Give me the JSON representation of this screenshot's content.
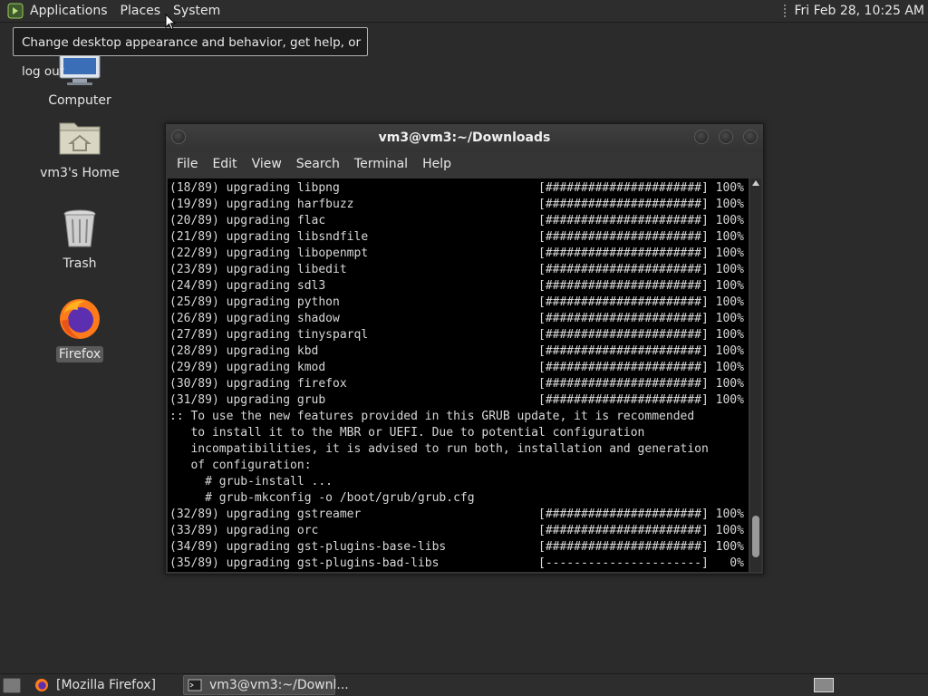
{
  "top_panel": {
    "menus": [
      "Applications",
      "Places",
      "System"
    ],
    "clock": "Fri Feb 28, 10:25 AM"
  },
  "tooltip": {
    "text": "Change desktop appearance and behavior, get help, or log out"
  },
  "desktop": {
    "icons": [
      {
        "label": "Computer",
        "icon": "computer-icon"
      },
      {
        "label": "vm3's Home",
        "icon": "home-folder-icon"
      },
      {
        "label": "Trash",
        "icon": "trash-icon"
      },
      {
        "label": "Firefox",
        "icon": "firefox-icon",
        "selected": true
      }
    ]
  },
  "terminal": {
    "title": "vm3@vm3:~/Downloads",
    "menu": [
      "File",
      "Edit",
      "View",
      "Search",
      "Terminal",
      "Help"
    ],
    "lines": [
      "(18/89) upgrading libpng                            [######################] 100%",
      "(19/89) upgrading harfbuzz                          [######################] 100%",
      "(20/89) upgrading flac                              [######################] 100%",
      "(21/89) upgrading libsndfile                        [######################] 100%",
      "(22/89) upgrading libopenmpt                        [######################] 100%",
      "(23/89) upgrading libedit                           [######################] 100%",
      "(24/89) upgrading sdl3                              [######################] 100%",
      "(25/89) upgrading python                            [######################] 100%",
      "(26/89) upgrading shadow                            [######################] 100%",
      "(27/89) upgrading tinysparql                        [######################] 100%",
      "(28/89) upgrading kbd                               [######################] 100%",
      "(29/89) upgrading kmod                              [######################] 100%",
      "(30/89) upgrading firefox                           [######################] 100%",
      "(31/89) upgrading grub                              [######################] 100%",
      ":: To use the new features provided in this GRUB update, it is recommended",
      "   to install it to the MBR or UEFI. Due to potential configuration",
      "   incompatibilities, it is advised to run both, installation and generation",
      "   of configuration:",
      "     # grub-install ...",
      "     # grub-mkconfig -o /boot/grub/grub.cfg",
      "(32/89) upgrading gstreamer                         [######################] 100%",
      "(33/89) upgrading orc                               [######################] 100%",
      "(34/89) upgrading gst-plugins-base-libs             [######################] 100%",
      "(35/89) upgrading gst-plugins-bad-libs              [----------------------]   0%"
    ]
  },
  "taskbar": {
    "tasks": [
      {
        "label": "[Mozilla Firefox]",
        "icon": "firefox-icon",
        "active": false
      },
      {
        "label": "vm3@vm3:~/Downl...",
        "icon": "terminal-icon",
        "active": true
      }
    ]
  }
}
